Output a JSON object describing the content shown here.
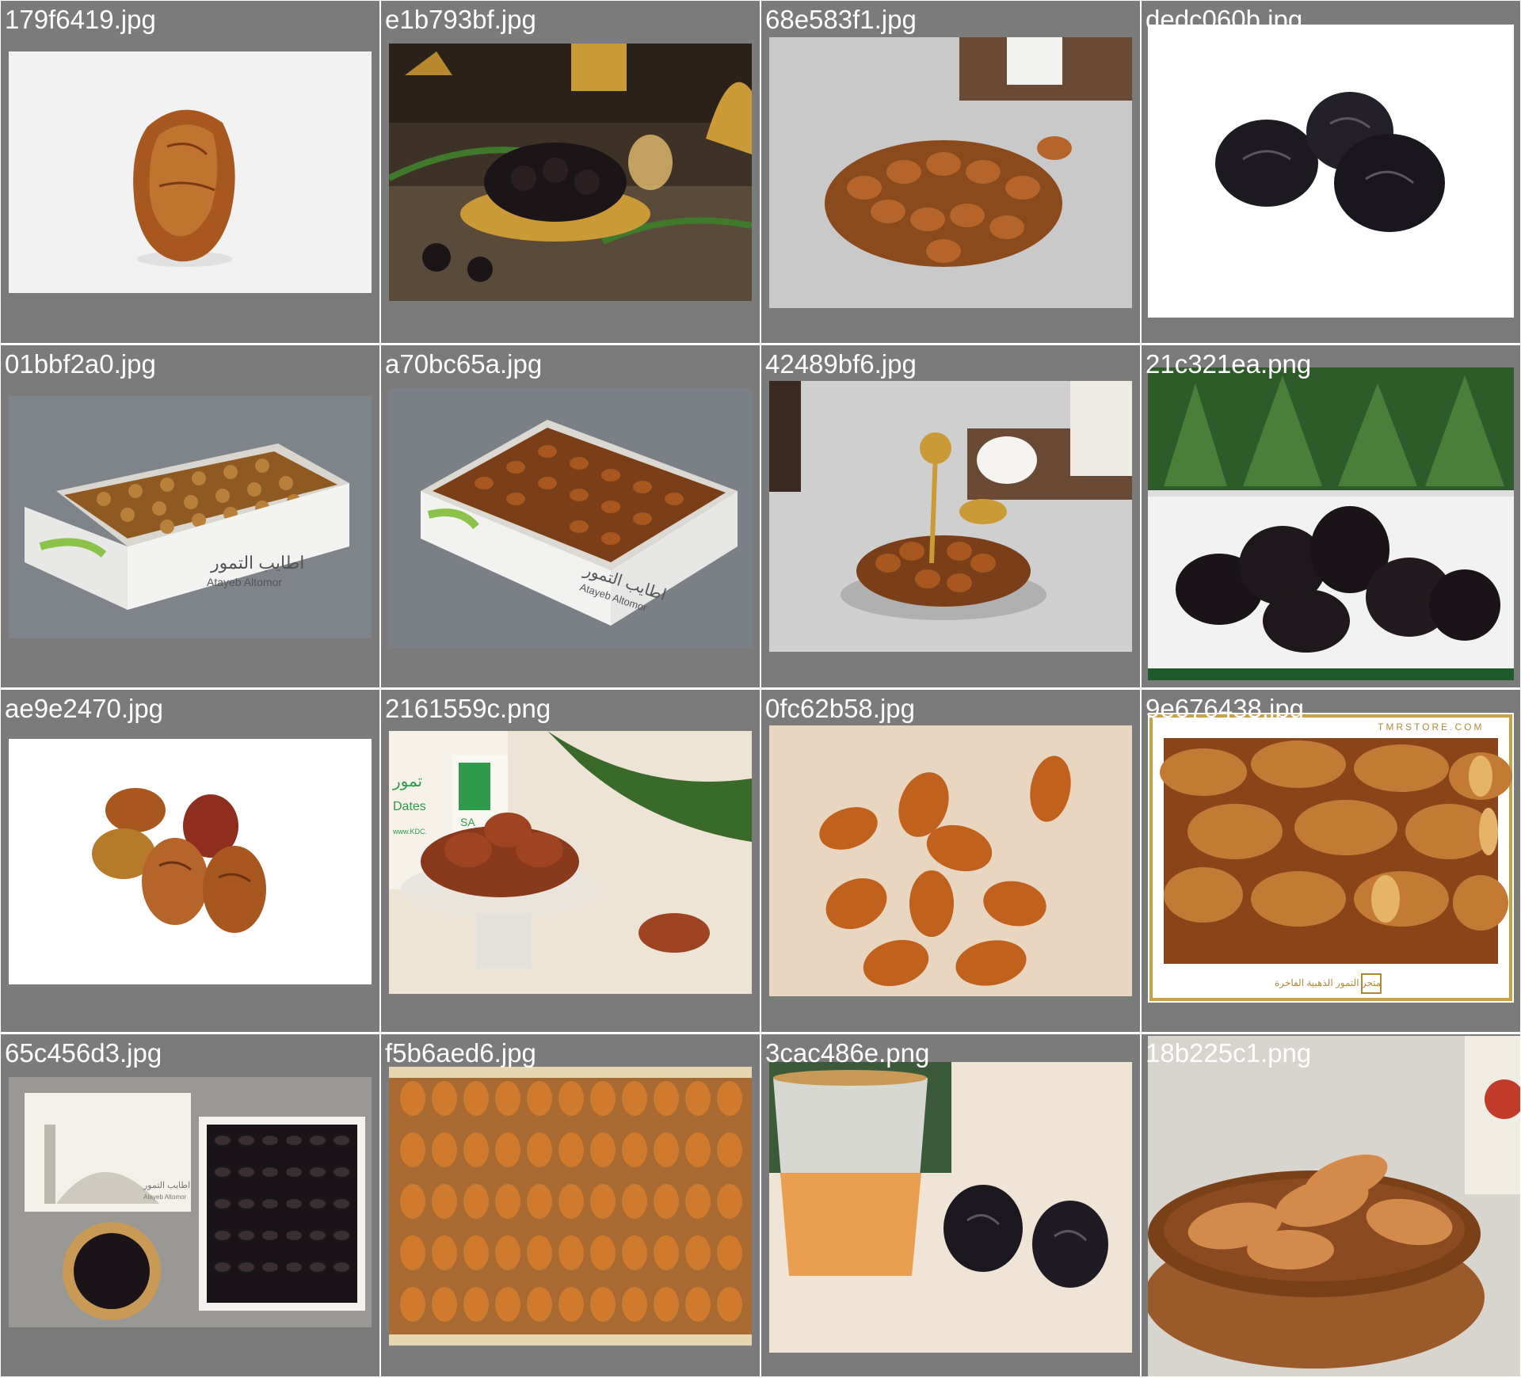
{
  "gallery": {
    "items": [
      {
        "filename": "179f6419.jpg",
        "subject": "single-date-icon"
      },
      {
        "filename": "e1b793bf.jpg",
        "subject": "dark-dates-gold-bowl-icon"
      },
      {
        "filename": "68e583f1.jpg",
        "subject": "date-pile-icon"
      },
      {
        "filename": "dedc060b.jpg",
        "subject": "three-dark-dates-icon"
      },
      {
        "filename": "01bbf2a0.jpg",
        "subject": "date-box-icon"
      },
      {
        "filename": "a70bc65a.jpg",
        "subject": "date-box-icon"
      },
      {
        "filename": "42489bf6.jpg",
        "subject": "dates-silver-tray-icon"
      },
      {
        "filename": "21c321ea.png",
        "subject": "dark-dates-palm-banner-icon"
      },
      {
        "filename": "ae9e2470.jpg",
        "subject": "date-cluster-icon"
      },
      {
        "filename": "2161559c.png",
        "subject": "dates-glass-bowl-icon"
      },
      {
        "filename": "0fc62b58.jpg",
        "subject": "scattered-dates-icon"
      },
      {
        "filename": "9e676438.jpg",
        "subject": "date-closeup-framed-icon"
      },
      {
        "filename": "65c456d3.jpg",
        "subject": "gift-box-dates-icon"
      },
      {
        "filename": "f5b6aed6.jpg",
        "subject": "date-tray-rows-icon"
      },
      {
        "filename": "3cac486e.png",
        "subject": "tea-cup-dates-icon"
      },
      {
        "filename": "18b225c1.png",
        "subject": "dates-wooden-bowl-icon"
      }
    ]
  },
  "scene_text": {
    "box_brand_arabic": "اطايب التمور",
    "box_brand_latin": "Atayeb Altomor",
    "tmrstore": "TMRSTORE.COM",
    "tmr_footer": "متجر التمور الذهبية الفاخرة",
    "kdc_arabic": "تمور",
    "kdc_dates": "Dates",
    "kdc_url": "www.KDC.",
    "kdc_sa": "SA",
    "gift_brand_arabic": "اطايب التمور",
    "gift_brand_latin": "Atayeb Altomor"
  },
  "colors": {
    "tile_bg": "#7b7b7b",
    "label": "#ffffff",
    "date_brown": "#b5652a",
    "date_dark": "#2b1f22"
  }
}
